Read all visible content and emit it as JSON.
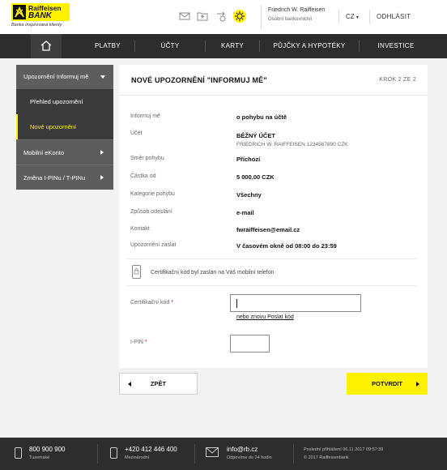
{
  "header": {
    "logo_name": "Raiffeisen",
    "logo_bank": "BANK",
    "logo_tagline": "Banka inspirovaná klienty",
    "icons": [
      "mail-icon",
      "folder-upload-icon",
      "transfer-icon",
      "cart-icon",
      "settings-icon"
    ],
    "user_name": "Friedrich W. Raiffeisen",
    "user_role": "Osobní bankovnictví",
    "language": "CZ",
    "logout": "ODHLÁSIT"
  },
  "nav": {
    "items": [
      "PLATBY",
      "ÚČTY",
      "KARTY",
      "PŮJČKY A HYPOTÉKY",
      "INVESTICE"
    ]
  },
  "sidebar": {
    "section": "Upozornění Informuj mě",
    "subitems": [
      "Přehled upozornění",
      "Nové upozornění"
    ],
    "items": [
      "Mobilní eKonto",
      "Změna I-PINu / T-PINu"
    ]
  },
  "card": {
    "title": "NOVÉ UPOZORNĚNÍ \"INFORMUJ MĚ\"",
    "step": "KROK 2 ZE 2",
    "rows": [
      {
        "label": "Informuj mě",
        "value": "o pohybu na účtě"
      },
      {
        "label": "Účet",
        "value": "BĚŽNÝ ÚČET",
        "sub": "FRIEDRICH W. RAIFFEISEN 1234567890 CZK"
      },
      {
        "label": "Směr pohybu",
        "value": "Příchozí"
      },
      {
        "label": "Částka od",
        "value": "5 000,00 CZK"
      },
      {
        "label": "Kategorie pohybu",
        "value": "Všechny"
      },
      {
        "label": "Způsob odeslání",
        "value": "e-mail"
      },
      {
        "label": "Kontakt",
        "value": "fwraiffeisen@email.cz"
      },
      {
        "label": "Upozornění zaslat",
        "value": "V časovém okně od 08:00 do 23:59"
      }
    ],
    "cert_note": "Certifikační kód byl zaslán na Váš mobilní telefon",
    "cert_label": "Certifikační kód",
    "required_mark": "*",
    "resend_link": "nebo znovu Poslat kód",
    "pin_label": "I-PIN"
  },
  "buttons": {
    "back": "ZPĚT",
    "confirm": "POTVRDIT"
  },
  "footer": {
    "phone1": "800 900 900",
    "phone1_sub": "Tuzemské",
    "phone2": "+420 412 446 400",
    "phone2_sub": "Mezinárodní",
    "email": "info@rb.cz",
    "email_sub": "Odpovíme do 24 hodin",
    "last_login": "Poslední přihlášení 06.11.2017 09:57:39",
    "copyright": "© 2017 Raiffeisenbank"
  },
  "colors": {
    "brand_yellow": "#fff200",
    "nav_dark": "#2d2d2d",
    "sidebar_gray": "#5d5d5d",
    "required_red": "#d0021b"
  }
}
